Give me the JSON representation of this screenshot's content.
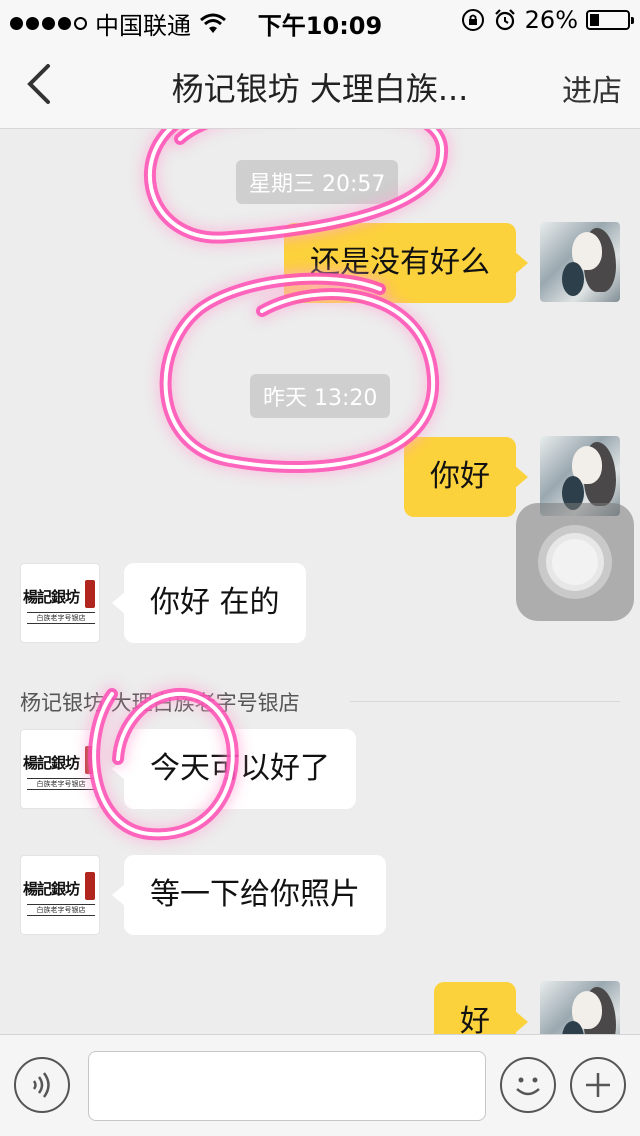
{
  "status_bar": {
    "carrier": "中国联通",
    "time": "下午10:09",
    "battery_percent": "26%",
    "battery_level": 0.26
  },
  "nav": {
    "title": "杨记银坊 大理白族...",
    "action_label": "进店"
  },
  "chat": {
    "timestamps": [
      "星期三 20:57",
      "昨天 13:20"
    ],
    "sender_name": "杨记银坊 大理白族老字号银店",
    "messages": [
      {
        "direction": "out",
        "text": "还是没有好么"
      },
      {
        "direction": "out",
        "text": "你好"
      },
      {
        "direction": "in",
        "text": "你好 在的"
      },
      {
        "direction": "in",
        "text": "今天可以好了"
      },
      {
        "direction": "in",
        "text": "等一下给你照片"
      },
      {
        "direction": "out",
        "text": "好"
      }
    ],
    "shop_avatar": {
      "name": "楊記銀坊",
      "subtitle": "白族老字号银店"
    }
  },
  "input_bar": {
    "placeholder": "",
    "value": ""
  },
  "colors": {
    "outgoing_bubble": "#fcd23c",
    "incoming_bubble": "#ffffff",
    "highlight": "#ff3fb3"
  }
}
